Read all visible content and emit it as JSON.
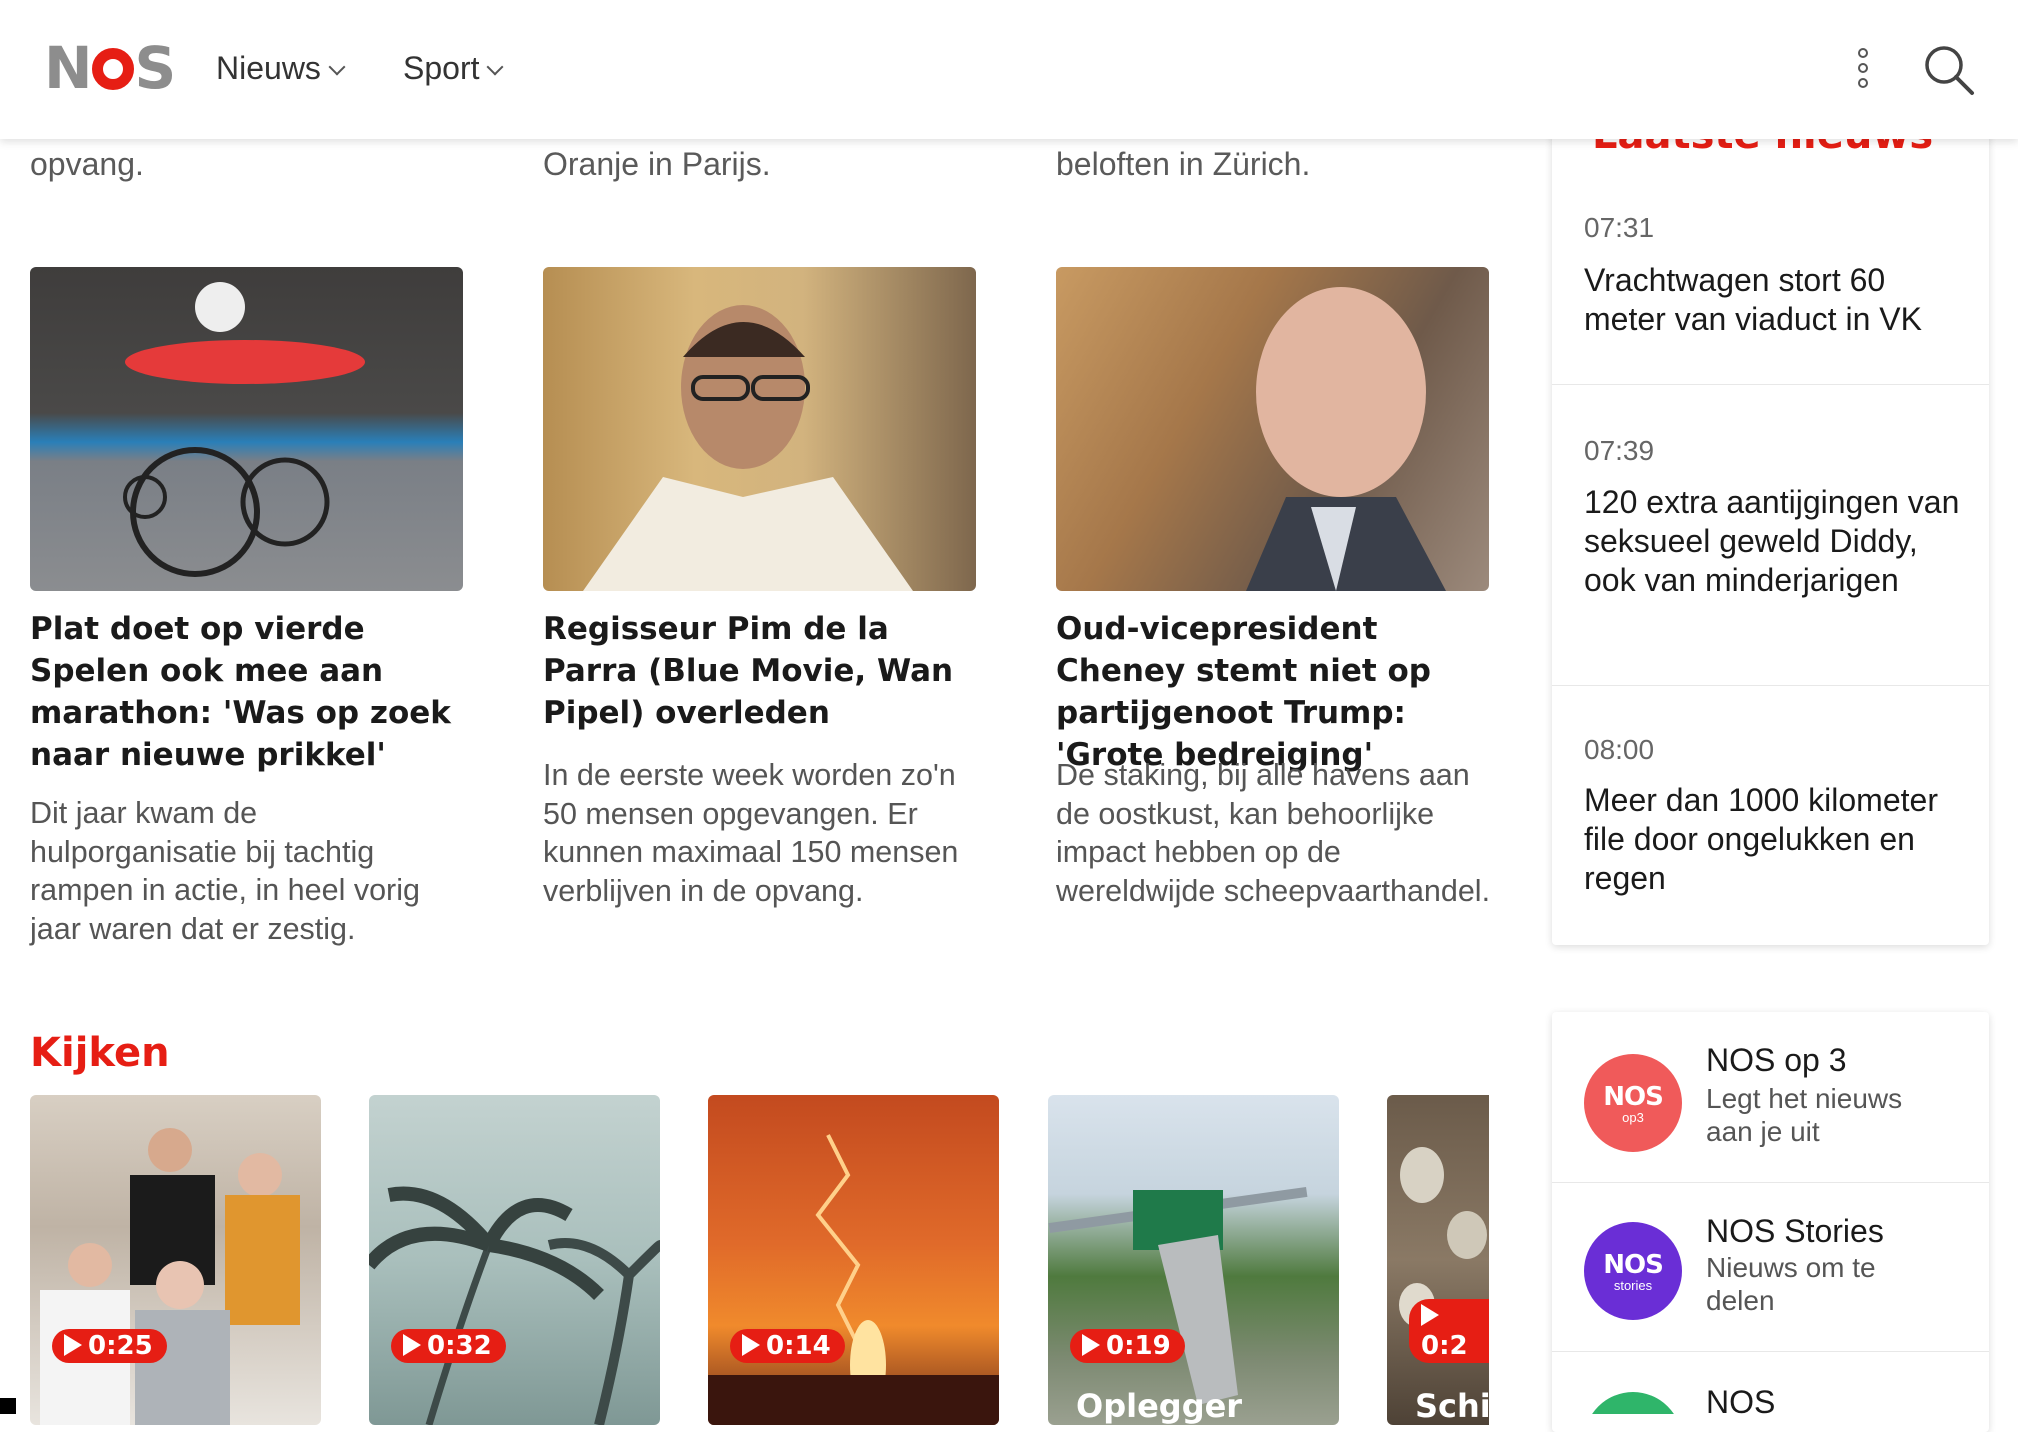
{
  "header": {
    "logo_text": "NOS",
    "nav": [
      {
        "label": "Nieuws"
      },
      {
        "label": "Sport"
      }
    ]
  },
  "top_fragments": [
    "opvang.",
    "Oranje in Parijs.",
    "beloften in Zürich."
  ],
  "articles": [
    {
      "title": "Plat doet op vierde Spelen ook mee aan marathon: 'Was op zoek naar nieuwe prikkel'",
      "description": "Dit jaar kwam de hulporganisatie bij tachtig rampen in actie, in heel vorig jaar waren dat er zestig.",
      "image": "wheelchair-racer-photo"
    },
    {
      "title": "Regisseur Pim de la Parra (Blue Movie, Wan Pipel) overleden",
      "description": "In de eerste week worden zo'n 50 mensen opgevangen. Er kunnen maximaal 150 mensen verblijven in de opvang.",
      "image": "director-portrait-photo"
    },
    {
      "title": "Oud-vicepresident Cheney stemt niet op partijgenoot Trump: 'Grote bedreiging'",
      "description": "De staking, bij alle havens aan de oostkust, kan behoorlijke impact hebben op de wereldwijde scheepvaarthandel.",
      "image": "elderly-man-photo"
    }
  ],
  "kijken": {
    "title": "Kijken",
    "videos": [
      {
        "duration": "0:25",
        "caption": ""
      },
      {
        "duration": "0:32",
        "caption": ""
      },
      {
        "duration": "0:14",
        "caption": ""
      },
      {
        "duration": "0:19",
        "caption": "Oplegger"
      },
      {
        "duration": "0:2",
        "caption": "Schil"
      }
    ]
  },
  "latest": {
    "heading": "Laatste nieuws",
    "items": [
      {
        "time": "07:31",
        "text": "Vrachtwagen stort 60 meter van viaduct in VK"
      },
      {
        "time": "07:39",
        "text": "120 extra aantijgingen van seksueel geweld Diddy, ook van minderjarigen"
      },
      {
        "time": "08:00",
        "text": "Meer dan 1000 kilometer file door ongelukken en regen"
      }
    ]
  },
  "apps": [
    {
      "name": "NOS op 3",
      "tagline": "Legt het nieuws aan je uit",
      "logo": "NOS",
      "logo_sub": "op3",
      "color": "#f05a5a"
    },
    {
      "name": "NOS Stories",
      "tagline": "Nieuws om te delen",
      "logo": "NOS",
      "logo_sub": "stories",
      "color": "#6a2ed6"
    },
    {
      "name": "NOS",
      "tagline": "",
      "logo": "",
      "logo_sub": "",
      "color": "#2fb56a"
    }
  ],
  "colors": {
    "accent": "#e61e14"
  }
}
